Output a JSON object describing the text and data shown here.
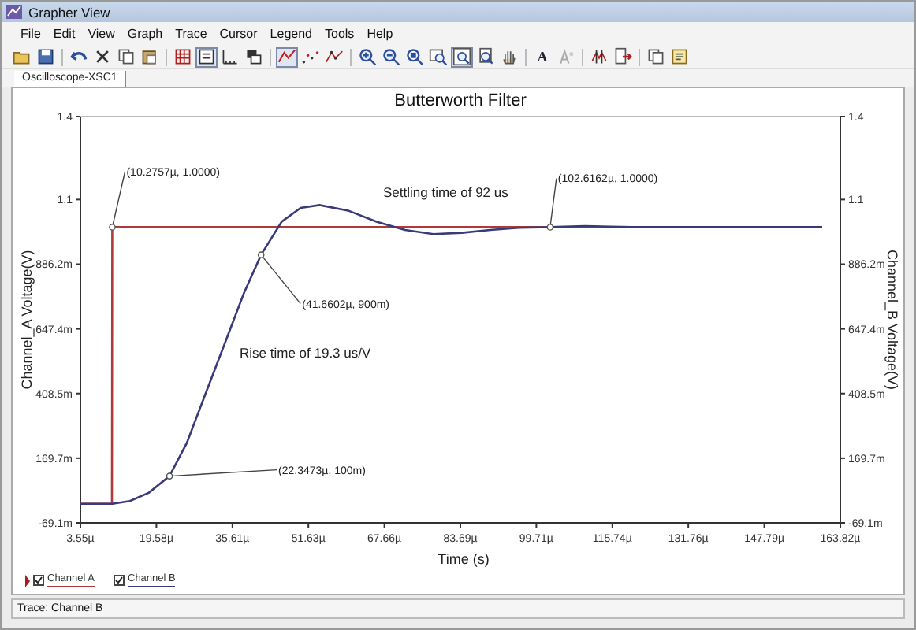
{
  "window": {
    "title": "Grapher View"
  },
  "menu": [
    "File",
    "Edit",
    "View",
    "Graph",
    "Trace",
    "Cursor",
    "Legend",
    "Tools",
    "Help"
  ],
  "toolbar": [
    {
      "kind": "open",
      "pressed": false
    },
    {
      "kind": "save",
      "pressed": false
    },
    {
      "kind": "sep"
    },
    {
      "kind": "undo",
      "pressed": false
    },
    {
      "kind": "delete",
      "pressed": false
    },
    {
      "kind": "copy",
      "pressed": false
    },
    {
      "kind": "paste",
      "pressed": false
    },
    {
      "kind": "sep"
    },
    {
      "kind": "grid",
      "pressed": false
    },
    {
      "kind": "legend",
      "pressed": true
    },
    {
      "kind": "ticks",
      "pressed": false
    },
    {
      "kind": "overlay",
      "pressed": false
    },
    {
      "kind": "sep"
    },
    {
      "kind": "line",
      "pressed": true
    },
    {
      "kind": "dots",
      "pressed": false
    },
    {
      "kind": "linedots",
      "pressed": false
    },
    {
      "kind": "sep"
    },
    {
      "kind": "zoomin",
      "pressed": false
    },
    {
      "kind": "zoomout",
      "pressed": false
    },
    {
      "kind": "zoomarea",
      "pressed": false
    },
    {
      "kind": "zoomx",
      "pressed": false
    },
    {
      "kind": "zoomfit",
      "pressed": true
    },
    {
      "kind": "zoomy",
      "pressed": false
    },
    {
      "kind": "pan",
      "pressed": false
    },
    {
      "kind": "sep"
    },
    {
      "kind": "text",
      "label": "A",
      "pressed": false
    },
    {
      "kind": "textdim",
      "pressed": false
    },
    {
      "kind": "sep"
    },
    {
      "kind": "cursors",
      "pressed": false
    },
    {
      "kind": "export",
      "pressed": false
    },
    {
      "kind": "sep"
    },
    {
      "kind": "copy",
      "pressed": false
    },
    {
      "kind": "properties",
      "pressed": false
    }
  ],
  "tabs": [
    {
      "label": "Oscilloscope-XSC1",
      "selected": true
    }
  ],
  "graph": {
    "chart_data": {
      "type": "line",
      "title": "Butterworth Filter",
      "xlabel": "Time (s)",
      "ylabel": "Channel_A Voltage(V)",
      "x": [
        3.55,
        10.2,
        10.2757,
        14,
        18,
        22.3473,
        26,
        30,
        34,
        38,
        41.6602,
        46,
        50,
        54,
        60,
        66,
        72,
        78,
        84,
        90,
        96,
        102.6162,
        110,
        120,
        130,
        140,
        150,
        160
      ],
      "series": [
        {
          "name": "Channel A",
          "color": "#b03a3a",
          "values": [
            0,
            0,
            1,
            1,
            1,
            1,
            1,
            1,
            1,
            1,
            1,
            1,
            1,
            1,
            1,
            1,
            1,
            1,
            1,
            1,
            1,
            1,
            1,
            1,
            1,
            null,
            null,
            null
          ]
        },
        {
          "name": "Channel B",
          "color": "#3a3a7a",
          "values": [
            0,
            0,
            0,
            0.01,
            0.04,
            0.1,
            0.22,
            0.4,
            0.58,
            0.76,
            0.9,
            1.02,
            1.07,
            1.08,
            1.06,
            1.02,
            0.99,
            0.975,
            0.98,
            0.99,
            0.998,
            1.0,
            1.004,
            1.0,
            1.0,
            1.0,
            1.0,
            1.0
          ]
        }
      ],
      "xlim": [
        3.55,
        163.82
      ],
      "ylim": [
        -0.0691,
        1.4
      ],
      "xticks": [
        {
          "value": 3.55,
          "label": "3.55µ"
        },
        {
          "value": 19.58,
          "label": "19.58µ"
        },
        {
          "value": 35.61,
          "label": "35.61µ"
        },
        {
          "value": 51.63,
          "label": "51.63µ"
        },
        {
          "value": 67.66,
          "label": "67.66µ"
        },
        {
          "value": 83.69,
          "label": "83.69µ"
        },
        {
          "value": 99.71,
          "label": "99.71µ"
        },
        {
          "value": 115.74,
          "label": "115.74µ"
        },
        {
          "value": 131.76,
          "label": "131.76µ"
        },
        {
          "value": 147.79,
          "label": "147.79µ"
        },
        {
          "value": 163.82,
          "label": "163.82µ"
        }
      ],
      "yticks": [
        {
          "value": 1.4,
          "label": "1.4"
        },
        {
          "value": 1.1,
          "label": "1.1"
        }
      ],
      "annotations": [
        {
          "text": "(10.2757µ, 1.0000)",
          "x": 10.2757,
          "y": 1.0
        },
        {
          "text": "(102.6162µ, 1.0000)",
          "x": 102.6162,
          "y": 1.0
        },
        {
          "text": "(41.6602µ, 900m)",
          "x": 41.6602,
          "y": 0.9
        },
        {
          "text": "(22.3473µ, 100m)",
          "x": 22.3473,
          "y": 0.1
        }
      ]
    },
    "left_axis": {
      "tick_labels": [
        "886.2m",
        "647.4m",
        "408.5m",
        "169.7m",
        "-69.1m"
      ]
    },
    "right_axis": {
      "title": "Channel_B Voltage(V)",
      "tick_labels": [
        "1.4",
        "1.1",
        "886.2m",
        "647.4m",
        "408.5m",
        "169.7m",
        "-69.1m"
      ]
    },
    "notes": [
      "Settling time of 92 us",
      "Rise time of 19.3 us/V"
    ]
  },
  "legend": [
    {
      "checked": true
    },
    {
      "checked": true
    }
  ],
  "status_bar": "Trace: Channel B"
}
